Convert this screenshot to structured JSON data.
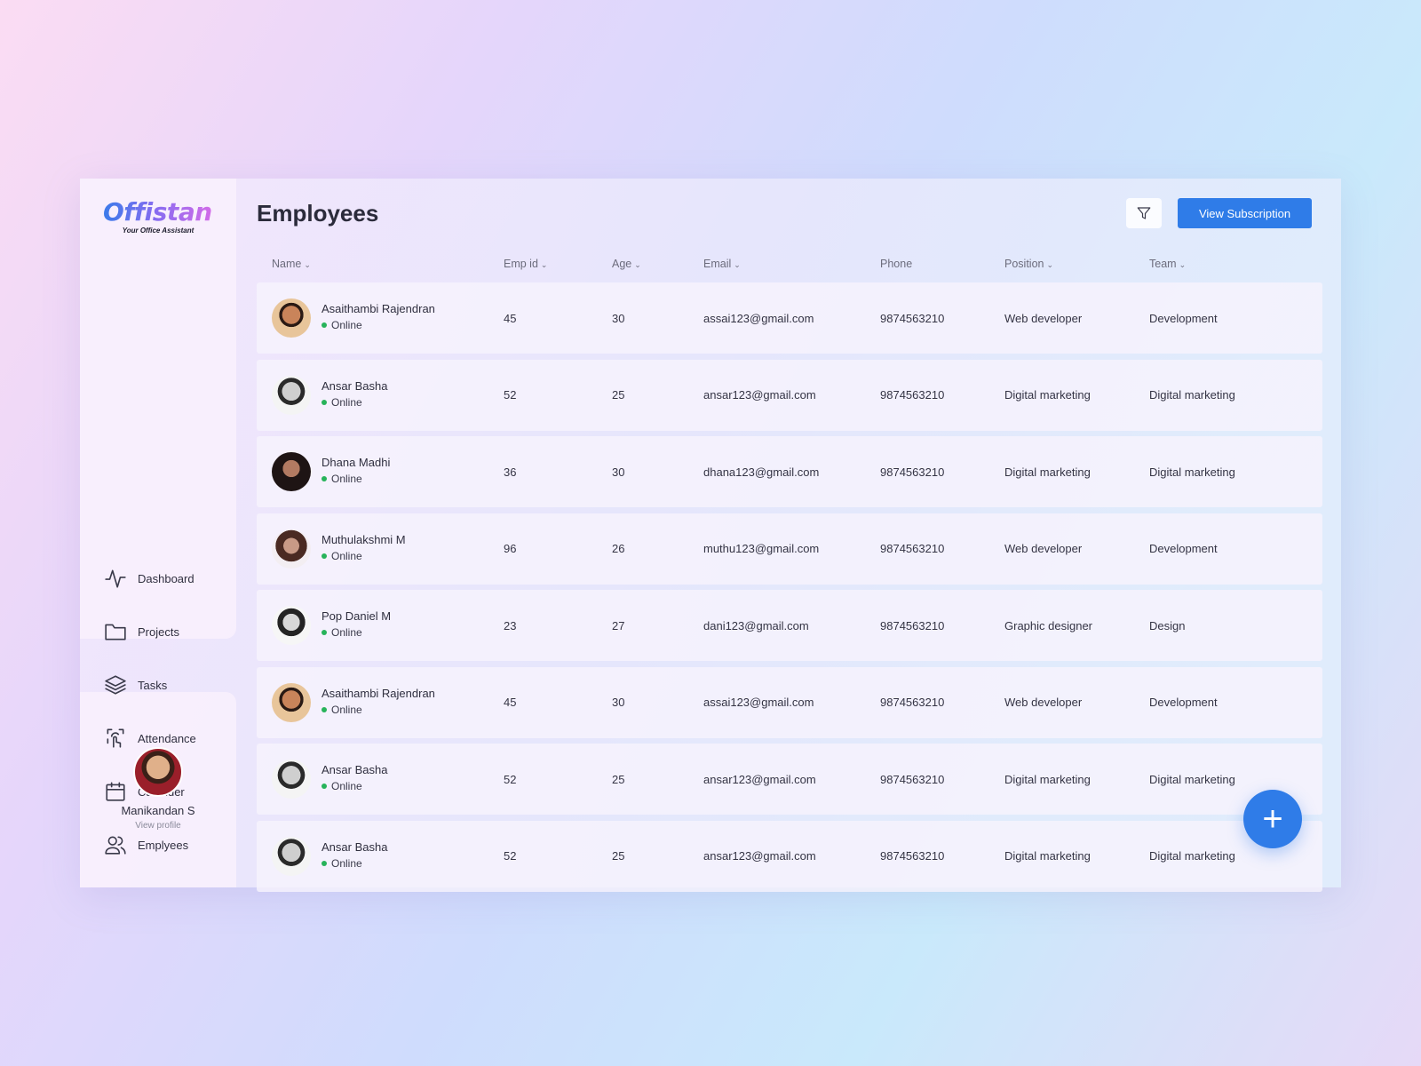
{
  "app": {
    "logo": "Offistant",
    "tagline": "Your Office Assistant"
  },
  "nav": [
    {
      "label": "Dashboard",
      "icon": "activity-icon"
    },
    {
      "label": "Projects",
      "icon": "folder-icon"
    },
    {
      "label": "Tasks",
      "icon": "layers-icon"
    },
    {
      "label": "Attendance",
      "icon": "touch-scan-icon"
    },
    {
      "label": "Calander",
      "icon": "calendar-icon"
    },
    {
      "label": "Emplyees",
      "icon": "users-icon",
      "active": true
    }
  ],
  "profile": {
    "name": "Manikandan S",
    "link": "View profile"
  },
  "header": {
    "title": "Employees",
    "subscription_button": "View Subscription",
    "filter_icon": "filter-icon"
  },
  "table": {
    "columns": [
      "Name",
      "Emp id",
      "Age",
      "Email",
      "Phone",
      "Position",
      "Team"
    ],
    "rows": [
      {
        "name": "Asaithambi Rajendran",
        "status": "Online",
        "emp_id": "45",
        "age": "30",
        "email": "assai123@gmail.com",
        "phone": "9874563210",
        "position": "Web developer",
        "team": "Development"
      },
      {
        "name": "Ansar Basha",
        "status": "Online",
        "emp_id": "52",
        "age": "25",
        "email": "ansar123@gmail.com",
        "phone": "9874563210",
        "position": "Digital marketing",
        "team": "Digital marketing"
      },
      {
        "name": "Dhana Madhi",
        "status": "Online",
        "emp_id": "36",
        "age": "30",
        "email": "dhana123@gmail.com",
        "phone": "9874563210",
        "position": "Digital marketing",
        "team": "Digital marketing"
      },
      {
        "name": "Muthulakshmi M",
        "status": "Online",
        "emp_id": "96",
        "age": "26",
        "email": "muthu123@gmail.com",
        "phone": "9874563210",
        "position": "Web developer",
        "team": "Development"
      },
      {
        "name": "Pop Daniel M",
        "status": "Online",
        "emp_id": "23",
        "age": "27",
        "email": "dani123@gmail.com",
        "phone": "9874563210",
        "position": "Graphic designer",
        "team": "Design"
      },
      {
        "name": "Asaithambi Rajendran",
        "status": "Online",
        "emp_id": "45",
        "age": "30",
        "email": "assai123@gmail.com",
        "phone": "9874563210",
        "position": "Web developer",
        "team": "Development"
      },
      {
        "name": "Ansar Basha",
        "status": "Online",
        "emp_id": "52",
        "age": "25",
        "email": "ansar123@gmail.com",
        "phone": "9874563210",
        "position": "Digital marketing",
        "team": "Digital marketing"
      },
      {
        "name": "Ansar Basha",
        "status": "Online",
        "emp_id": "52",
        "age": "25",
        "email": "ansar123@gmail.com",
        "phone": "9874563210",
        "position": "Digital marketing",
        "team": "Digital marketing"
      }
    ]
  },
  "fab": {
    "label": "+",
    "icon": "plus-icon"
  },
  "colors": {
    "accent": "#2f7ce8",
    "online": "#27b35a"
  }
}
